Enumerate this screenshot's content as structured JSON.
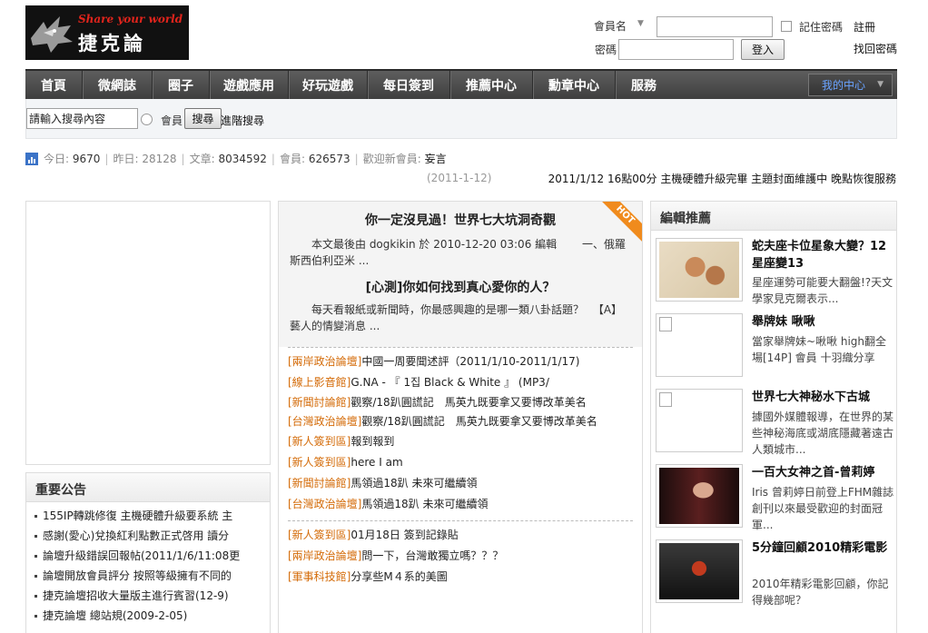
{
  "logo": {
    "tagline": "Share your world",
    "name": "捷克論"
  },
  "login": {
    "username_label": "會員名",
    "password_label": "密碼",
    "remember_label": "記住密碼",
    "register_link": "註冊",
    "forgot_link": "找回密碼",
    "login_button": "登入"
  },
  "nav": {
    "items": [
      "首頁",
      "微網誌",
      "圈子",
      "遊戲應用",
      "好玩遊戲",
      "每日簽到",
      "推薦中心",
      "勳章中心",
      "服務"
    ],
    "center_button": "我的中心"
  },
  "search": {
    "placeholder": "請輸入搜尋內容",
    "value": "請輸入搜尋內容",
    "radio_label": "會員",
    "button": "搜尋",
    "advanced": "進階搜尋"
  },
  "stats": {
    "today_label": "今日:",
    "today": "9670",
    "yesterday_label": "昨日:",
    "yesterday": "28128",
    "posts_label": "文章:",
    "posts": "8034592",
    "members_label": "會員:",
    "members": "626573",
    "welcome_label": "歡迎新會員:",
    "new_member": "妄言"
  },
  "notice": {
    "date": "(2011-1-12)",
    "text": "2011/1/12 16點00分 主機硬體升級完畢 主題封面維護中 晚點恢復服務"
  },
  "announcements": {
    "title": "重要公告",
    "items": [
      "155IP轉跳修復 主機硬體升級要系統 主",
      "感謝(愛心)兌換紅利點數正式啓用 讀分",
      "論壇升級錯誤回報帖(2011/1/6/11:08更",
      "論壇開放會員評分 按照等級擁有不同的",
      "捷克論壇招收大量版主進行賓習(12-9)",
      "捷克論壇 總站規(2009-2-05)"
    ]
  },
  "featured": {
    "hot_label": "HOT",
    "headline1": "你一定沒見過！世界七大坑洞奇觀",
    "summary1": "本文最後由 dogkikin 於 2010-12-20 03:06 編輯 　　一、俄羅斯西伯利亞米 ...",
    "headline2": "[心測]你如何找到真心愛你的人？",
    "summary2": "每天看報紙或新聞時，你最感興趣的是哪一類八卦話題？ 　【A】藝人的情變消息 ..."
  },
  "threads": {
    "group1": [
      {
        "cat": "[兩岸政治論壇]",
        "title": "中國一周要聞述評（2011/1/10-2011/1/17)"
      },
      {
        "cat": "[線上影音館]",
        "title": "G.NA - 『 1집 Black & White 』 (MP3/"
      },
      {
        "cat": "[新聞討論館]",
        "title": "觀察/18趴圓謊記　馬英九既要拿又要博改革美名"
      },
      {
        "cat": "[台灣政治論壇]",
        "title": "觀察/18趴圓謊記　馬英九既要拿又要博改革美名"
      },
      {
        "cat": "[新人簽到區]",
        "title": "報到報到"
      },
      {
        "cat": "[新人簽到區]",
        "title": "here I am"
      },
      {
        "cat": "[新聞討論館]",
        "title": "馬領過18趴 未來可繼續領"
      },
      {
        "cat": "[台灣政治論壇]",
        "title": "馬領過18趴 未來可繼續領"
      }
    ],
    "group2": [
      {
        "cat": "[新人簽到區]",
        "title": "01月18日 簽到記錄貼"
      },
      {
        "cat": "[兩岸政治論壇]",
        "title": "問一下，台灣敢獨立嗎？？？"
      },
      {
        "cat": "[軍事科技館]",
        "title": "分享些M４系的美圖"
      }
    ]
  },
  "editor_picks": {
    "title": "編輯推薦",
    "items": [
      {
        "title": "蛇夫座卡位星象大變？12星座變13",
        "desc": "星座運勢可能要大翻盤!?天文學家見克爾表示..."
      },
      {
        "title": "舉牌妹 啾啾",
        "desc": "當家舉牌妹~啾啾 high翻全場[14P] 會員 十羽織分享"
      },
      {
        "title": "世界七大神秘水下古城",
        "desc": "據國外媒體報導，在世界的某些神秘海底或湖底隱藏著遠古人類城市..."
      },
      {
        "title": "一百大女神之首-曾莉婷",
        "desc": "Iris 曾莉婷日前登上FHM雜誌創刊以來最受歡迎的封面冠軍..."
      },
      {
        "title": "5分鐘回顧2010精彩電影",
        "desc": "2010年精彩電影回顧，你記得幾部呢？"
      }
    ]
  }
}
